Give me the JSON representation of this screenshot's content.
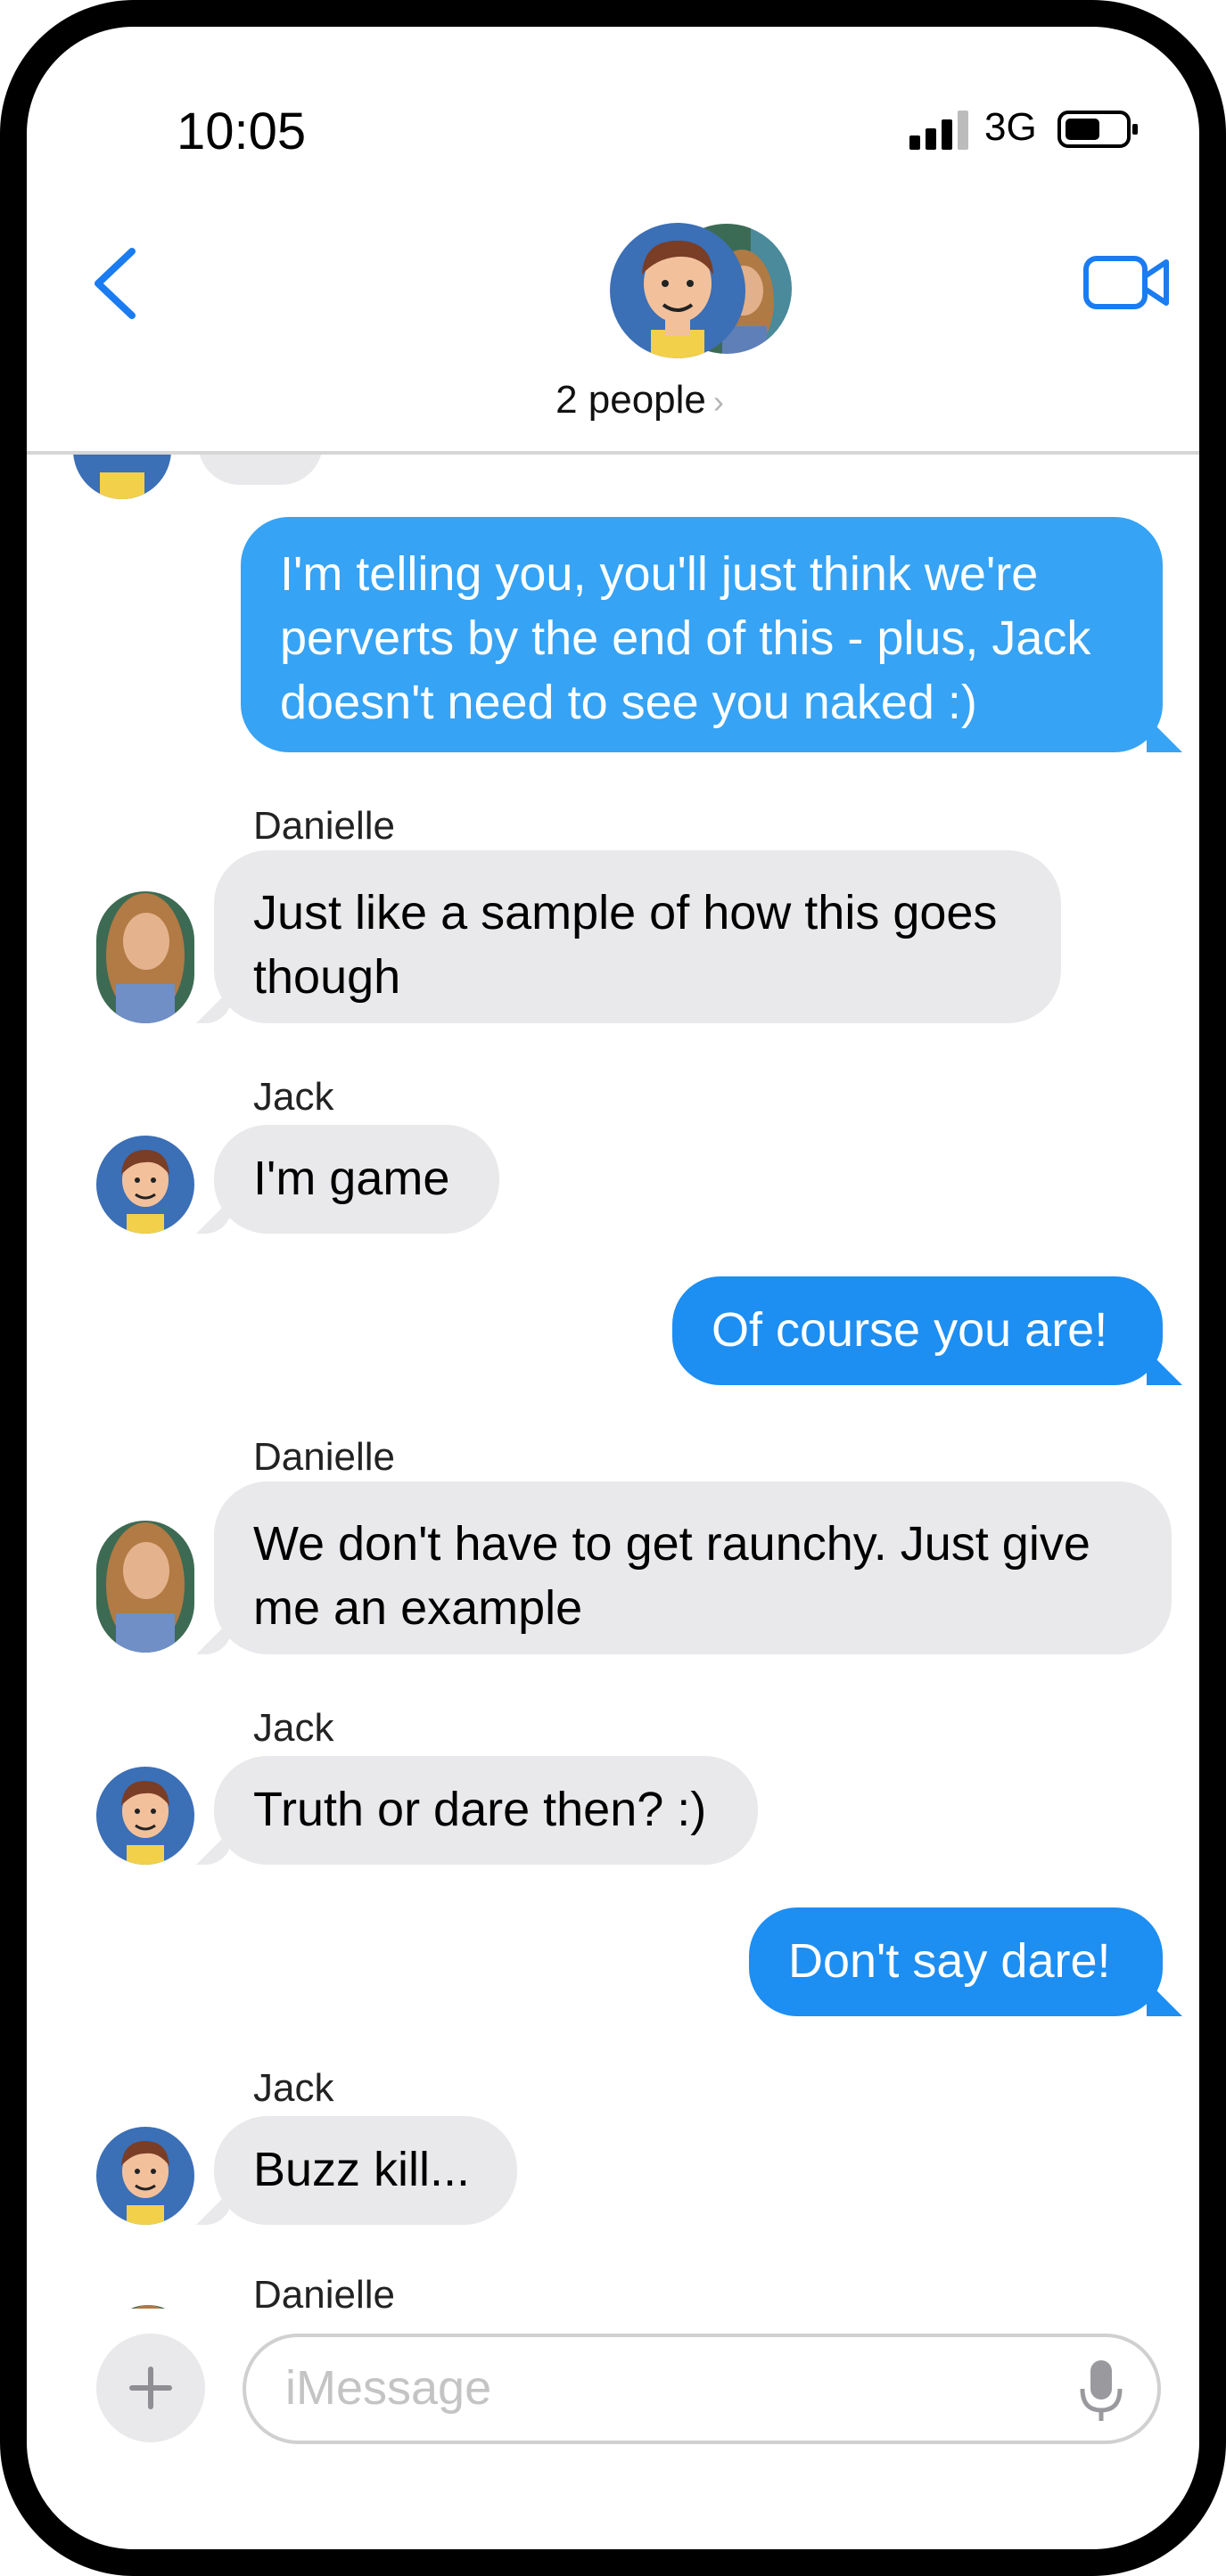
{
  "status_bar": {
    "time": "10:05",
    "network": "3G"
  },
  "header": {
    "title": "2 people",
    "chevron": "›"
  },
  "messages": [
    {
      "from": "me",
      "text_lines": [
        "I'm telling you, you'll just think we're",
        "perverts by the end of this - plus, Jack",
        "doesn't need to see you naked :)"
      ]
    },
    {
      "from": "Danielle",
      "sender": "Danielle",
      "text_lines": [
        "Just like a sample of how this goes",
        "though"
      ]
    },
    {
      "from": "Jack",
      "sender": "Jack",
      "text_lines": [
        "I'm game"
      ]
    },
    {
      "from": "me",
      "text_lines": [
        "Of course you are!"
      ]
    },
    {
      "from": "Danielle",
      "sender": "Danielle",
      "text_lines": [
        "We don't have to get raunchy.  Just give",
        "me an example"
      ]
    },
    {
      "from": "Jack",
      "sender": "Jack",
      "text_lines": [
        "Truth or dare then? :)"
      ]
    },
    {
      "from": "me",
      "text_lines": [
        "Don't say dare!"
      ]
    },
    {
      "from": "Jack",
      "sender": "Jack",
      "text_lines": [
        "Buzz kill..."
      ]
    },
    {
      "from": "Danielle",
      "sender": "Danielle"
    }
  ],
  "composer": {
    "placeholder": "iMessage"
  },
  "icons": {
    "back": "chevron-left-icon",
    "video": "video-camera-icon",
    "plus": "plus-icon",
    "mic": "microphone-icon"
  },
  "colors": {
    "accent": "#1a7cf0",
    "outgoing_bubble": "#36a3f5",
    "incoming_bubble": "#e9e9eb",
    "jack_avatar_bg": "#3b6fb6"
  }
}
